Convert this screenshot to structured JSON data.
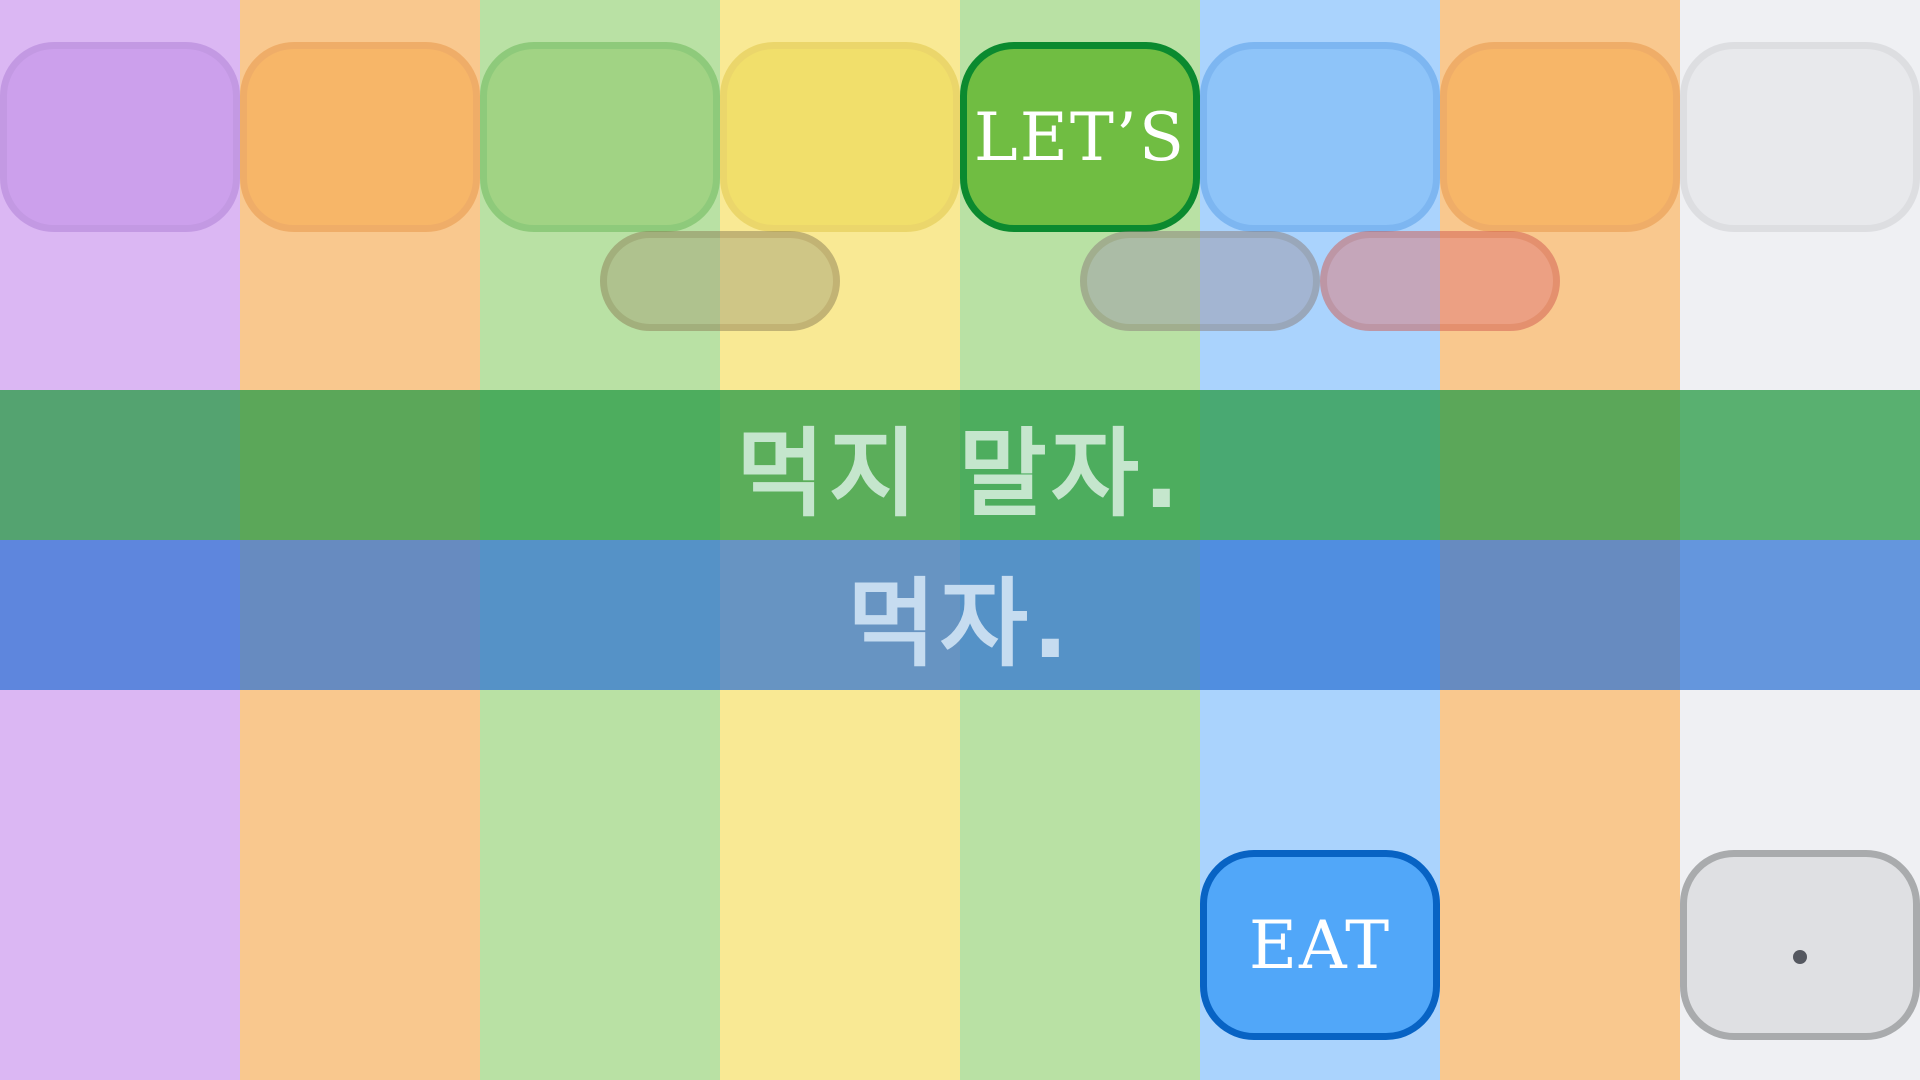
{
  "columns": [
    {
      "color": "#dbb7f3"
    },
    {
      "color": "#f9c88e"
    },
    {
      "color": "#b9e1a4"
    },
    {
      "color": "#f9e994"
    },
    {
      "color": "#b9e1a4"
    },
    {
      "color": "#aad3fd"
    },
    {
      "color": "#f9c88e"
    },
    {
      "color": "#eff0f3"
    }
  ],
  "bands": {
    "top": {
      "text": "먹지 말자.",
      "color": "#2e9d4a",
      "text_color": "#c5e6cd"
    },
    "bottom": {
      "text": "먹자.",
      "color": "#2e73d4",
      "text_color": "#c6dcf0"
    }
  },
  "tiles": {
    "lets": {
      "label": "LET’S",
      "fill": "#70bd42",
      "border": "#0b8a2f"
    },
    "eat": {
      "label": "EAT",
      "fill": "#51a7f9",
      "border": "#0863c4"
    },
    "period": {
      "label": ".",
      "fill": "#dfe0e3",
      "border": "#a9abad",
      "dot_color": "#555860"
    }
  },
  "ghost_tiles": [
    {
      "fill": "#c08ee8",
      "border": "#b081d6"
    },
    {
      "fill": "#f7a84a",
      "border": "#e8984a"
    },
    {
      "fill": "#8ec96a",
      "border": "#6bb85a"
    },
    {
      "fill": "#ecd84a",
      "border": "#e0c84a"
    },
    {
      "fill": "#78b9f7",
      "border": "#5aa0e8"
    },
    {
      "fill": "#f7a84a",
      "border": "#e8984a"
    },
    {
      "fill": "#e3e4e8",
      "border": "#cfd0d4"
    }
  ],
  "pills": [
    {
      "fill": "#a7a57a",
      "border": "#8c7f55"
    },
    {
      "fill": "#9e99a8",
      "border": "#8a7d7a"
    },
    {
      "fill": "#e07a7a",
      "border": "#d05a50"
    }
  ]
}
